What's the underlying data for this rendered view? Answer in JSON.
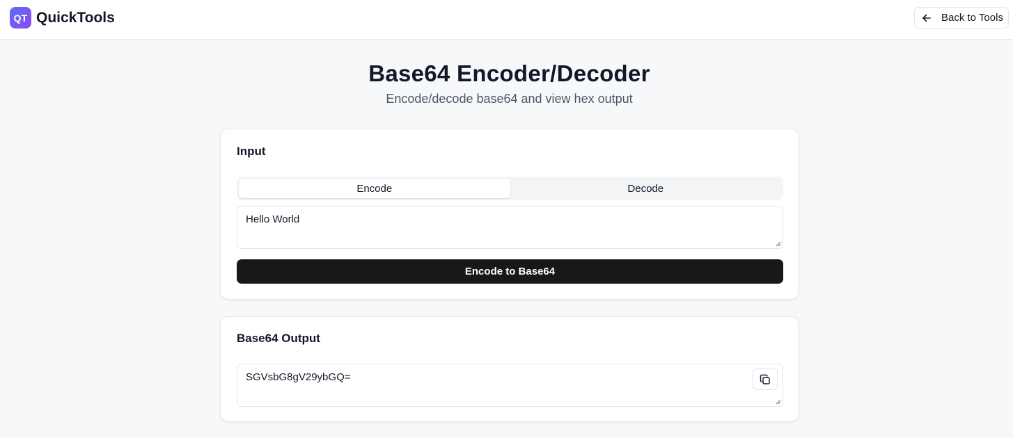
{
  "header": {
    "logo_text": "QT",
    "brand": "QuickTools",
    "back_label": "Back to Tools",
    "accent_gradient": [
      "#5b6cf5",
      "#8b4cf0"
    ]
  },
  "page": {
    "title": "Base64 Encoder/Decoder",
    "subtitle": "Encode/decode base64 and view hex output"
  },
  "input_card": {
    "title": "Input",
    "tabs": [
      {
        "label": "Encode",
        "active": true
      },
      {
        "label": "Decode",
        "active": false
      }
    ],
    "input_value": "Hello World",
    "action_label": "Encode to Base64"
  },
  "output_card": {
    "title": "Base64 Output",
    "output_value": "SGVsbG8gV29ybGQ=",
    "copy_icon": "copy-icon"
  },
  "colors": {
    "primary_button": "#18181b",
    "background": "#f7f8fa"
  }
}
